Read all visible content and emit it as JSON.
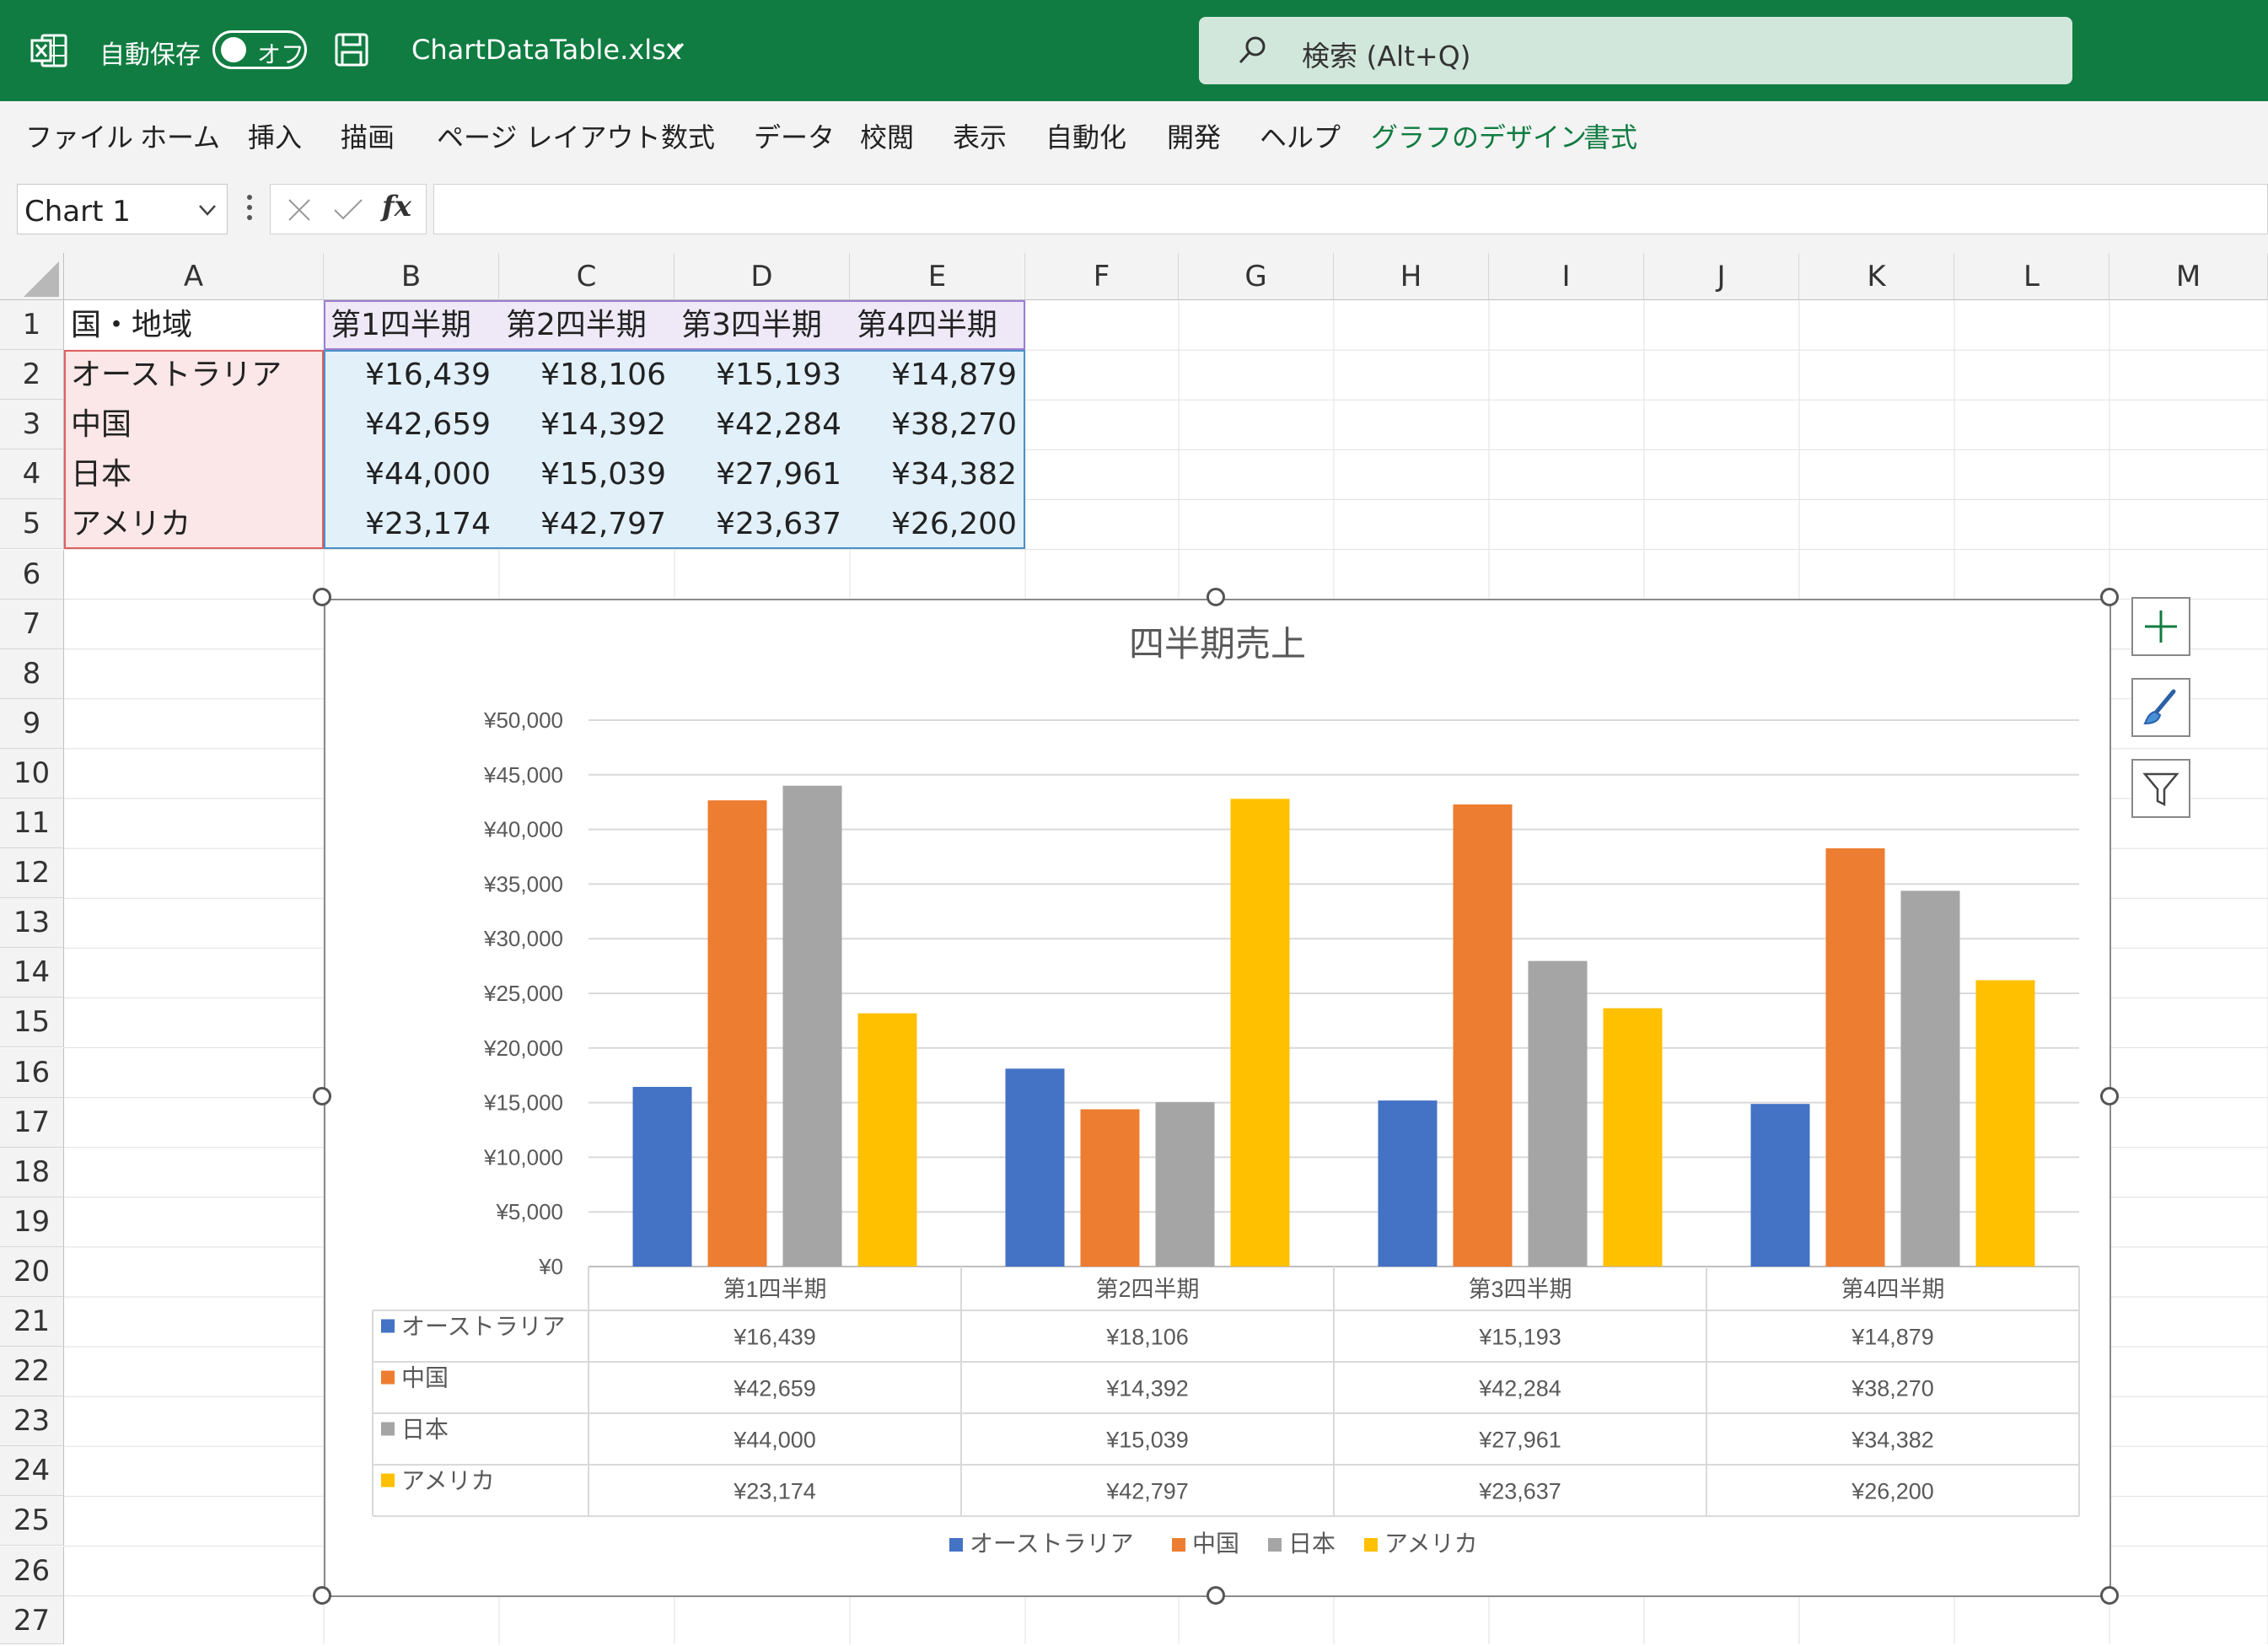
{
  "titlebar": {
    "autosave_label": "自動保存",
    "autosave_state": "オフ",
    "filename": "ChartDataTable.xlsx",
    "search_placeholder": "検索 (Alt+Q)"
  },
  "ribbon_tabs": [
    "ファイル",
    "ホーム",
    "挿入",
    "描画",
    "ページ レイアウト",
    "数式",
    "データ",
    "校閲",
    "表示",
    "自動化",
    "開発",
    "ヘルプ",
    "グラフのデザイン",
    "書式"
  ],
  "formula_bar": {
    "name_box": "Chart 1",
    "fx": "fx",
    "formula": ""
  },
  "columns": [
    "A",
    "B",
    "C",
    "D",
    "E",
    "F",
    "G",
    "H",
    "I",
    "J",
    "K",
    "L",
    "M"
  ],
  "rows": [
    "1",
    "2",
    "3",
    "4",
    "5",
    "6",
    "7",
    "8",
    "9",
    "10",
    "11",
    "12",
    "13",
    "14",
    "15",
    "16",
    "17",
    "18",
    "19",
    "20",
    "21",
    "22",
    "23",
    "24",
    "25",
    "26",
    "27"
  ],
  "sheet": {
    "header": [
      "国・地域",
      "第1四半期",
      "第2四半期",
      "第3四半期",
      "第4四半期"
    ],
    "data": [
      [
        "オーストラリア",
        "¥16,439",
        "¥18,106",
        "¥15,193",
        "¥14,879"
      ],
      [
        "中国",
        "¥42,659",
        "¥14,392",
        "¥42,284",
        "¥38,270"
      ],
      [
        "日本",
        "¥44,000",
        "¥15,039",
        "¥27,961",
        "¥34,382"
      ],
      [
        "アメリカ",
        "¥23,174",
        "¥42,797",
        "¥23,637",
        "¥26,200"
      ]
    ]
  },
  "chart_data": {
    "type": "bar",
    "title": "四半期売上",
    "categories": [
      "第1四半期",
      "第2四半期",
      "第3四半期",
      "第4四半期"
    ],
    "series": [
      {
        "name": "オーストラリア",
        "color": "#4472c4",
        "values": [
          16439,
          18106,
          15193,
          14879
        ],
        "labels": [
          "¥16,439",
          "¥18,106",
          "¥15,193",
          "¥14,879"
        ]
      },
      {
        "name": "中国",
        "color": "#ed7d31",
        "values": [
          42659,
          14392,
          42284,
          38270
        ],
        "labels": [
          "¥42,659",
          "¥14,392",
          "¥42,284",
          "¥38,270"
        ]
      },
      {
        "name": "日本",
        "color": "#a5a5a5",
        "values": [
          44000,
          15039,
          27961,
          34382
        ],
        "labels": [
          "¥44,000",
          "¥15,039",
          "¥27,961",
          "¥34,382"
        ]
      },
      {
        "name": "アメリカ",
        "color": "#ffc000",
        "values": [
          23174,
          42797,
          23637,
          26200
        ],
        "labels": [
          "¥23,174",
          "¥42,797",
          "¥23,637",
          "¥26,200"
        ]
      }
    ],
    "ylim": [
      0,
      50000
    ],
    "ytick_labels": [
      "¥0",
      "¥5,000",
      "¥10,000",
      "¥15,000",
      "¥20,000",
      "¥25,000",
      "¥30,000",
      "¥35,000",
      "¥40,000",
      "¥45,000",
      "¥50,000"
    ],
    "grid": true,
    "data_table": true,
    "legend": "bottom"
  }
}
